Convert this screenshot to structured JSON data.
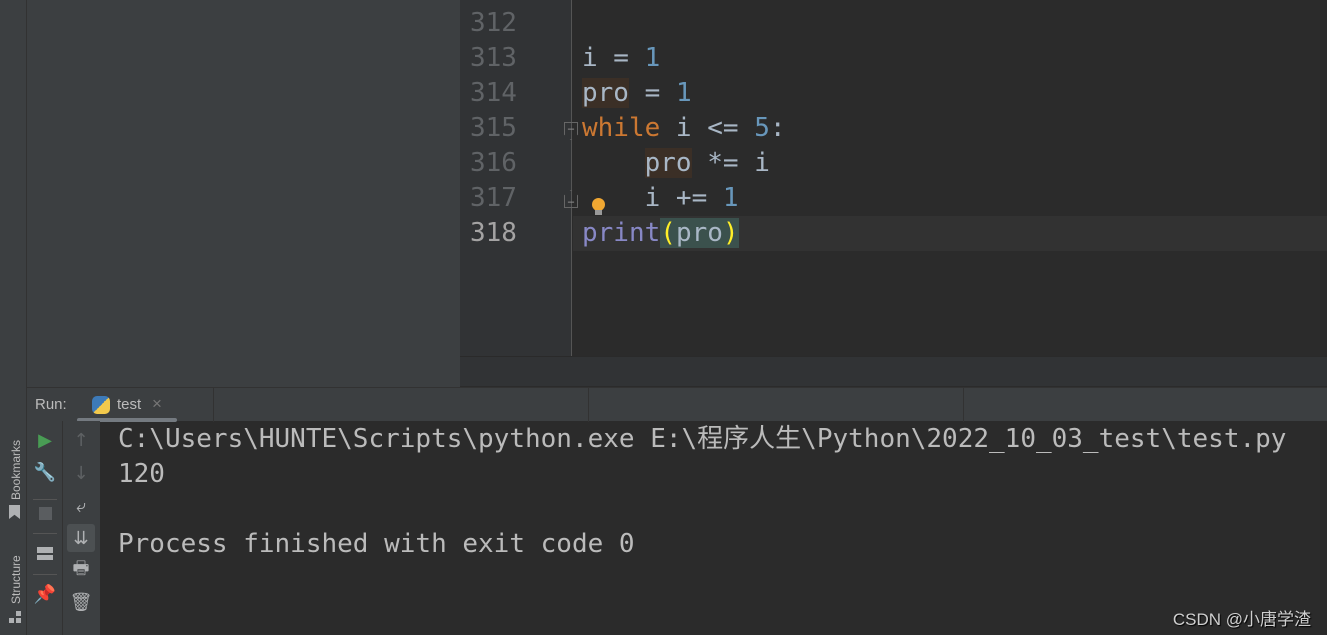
{
  "editor": {
    "line_numbers": [
      "312",
      "313",
      "314",
      "315",
      "316",
      "317",
      "318"
    ],
    "current_line": "318",
    "lines": [
      {
        "tokens": []
      },
      {
        "tokens": [
          {
            "t": "i",
            "c": ""
          },
          {
            "t": " = ",
            "c": ""
          },
          {
            "t": "1",
            "c": "num"
          }
        ]
      },
      {
        "tokens": [
          {
            "t": "pro",
            "c": "hl"
          },
          {
            "t": " = ",
            "c": ""
          },
          {
            "t": "1",
            "c": "num"
          }
        ]
      },
      {
        "tokens": [
          {
            "t": "while",
            "c": "kw"
          },
          {
            "t": " i <= ",
            "c": ""
          },
          {
            "t": "5",
            "c": "num"
          },
          {
            "t": ":",
            "c": ""
          }
        ]
      },
      {
        "tokens": [
          {
            "t": "    ",
            "c": ""
          },
          {
            "t": "pro",
            "c": "hl"
          },
          {
            "t": " *= i",
            "c": ""
          }
        ]
      },
      {
        "tokens": [
          {
            "t": "    i += ",
            "c": ""
          },
          {
            "t": "1",
            "c": "num"
          }
        ]
      },
      {
        "tokens": [
          {
            "t": "print",
            "c": "fn"
          },
          {
            "t": "(",
            "c": "br"
          },
          {
            "t": "pro",
            "c": "brn"
          },
          {
            "t": ")",
            "c": "br"
          }
        ]
      }
    ],
    "intention_icon": "lightbulb-icon"
  },
  "sidebar": {
    "bookmarks_label": "Bookmarks",
    "structure_label": "Structure"
  },
  "run": {
    "label": "Run:",
    "tab_label": "test",
    "tab_icon": "python-icon",
    "toolbar_left": [
      "run-icon",
      "wrench-icon",
      "stop-icon",
      "layout-icon",
      "pin-icon"
    ],
    "toolbar_right": [
      "arrow-up-icon",
      "arrow-down-icon",
      "soft-wrap-icon",
      "scroll-to-end-icon",
      "print-icon",
      "trash-icon"
    ],
    "console": [
      "C:\\Users\\HUNTE\\Scripts\\python.exe E:\\程序人生\\Python\\2022_10_03_test\\test.py",
      "120",
      "",
      "Process finished with exit code 0"
    ]
  },
  "watermark": "CSDN @小唐学渣",
  "colors": {
    "keyword": "#cc7832",
    "number": "#6897bb",
    "builtin": "#8888c6",
    "run_green": "#499c54"
  }
}
